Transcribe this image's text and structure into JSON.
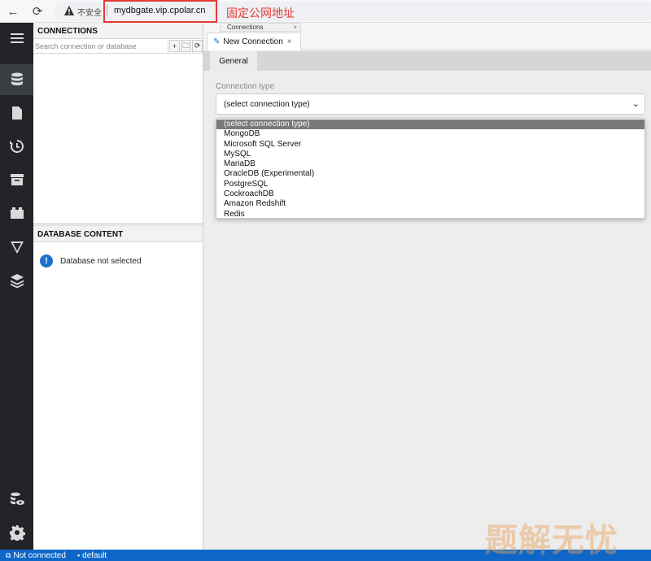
{
  "browser": {
    "back_icon": "←",
    "reload_icon": "⟳",
    "insecure_label": "不安全",
    "url": "mydbgate.vip.cpolar.cn",
    "annotation": "固定公网地址"
  },
  "sidebar": {
    "items": [
      "menu-icon",
      "database-icon",
      "file-icon",
      "history-icon",
      "archive-icon",
      "plugin-icon",
      "cell-data-icon",
      "layers-icon"
    ],
    "bottom_items": [
      "database-eye-icon",
      "settings-icon"
    ]
  },
  "connections_panel": {
    "title": "CONNECTIONS",
    "search_placeholder": "Search connection or database",
    "add_icon": "+",
    "folder_icon": "🗀",
    "refresh_icon": "⟳"
  },
  "db_content_panel": {
    "title": "DATABASE CONTENT",
    "info_icon": "!",
    "message": "Database not selected"
  },
  "tabs": {
    "mini_tab": "Connections",
    "mini_tab_close": "×",
    "main_tab": "New Connection",
    "main_tab_close": "×",
    "pin_icon": "📌"
  },
  "form": {
    "general_tab": "General",
    "connection_type_label": "Connection type",
    "selected_value": "(select connection type)",
    "options": [
      "(select connection type)",
      "MongoDB",
      "Microsoft SQL Server",
      "MySQL",
      "MariaDB",
      "OracleDB (Experimental)",
      "PostgreSQL",
      "CockroachDB",
      "Amazon Redshift",
      "Redis"
    ]
  },
  "statusbar": {
    "connection_status": "Not connected",
    "database": "default"
  },
  "watermark": "题解无忧"
}
